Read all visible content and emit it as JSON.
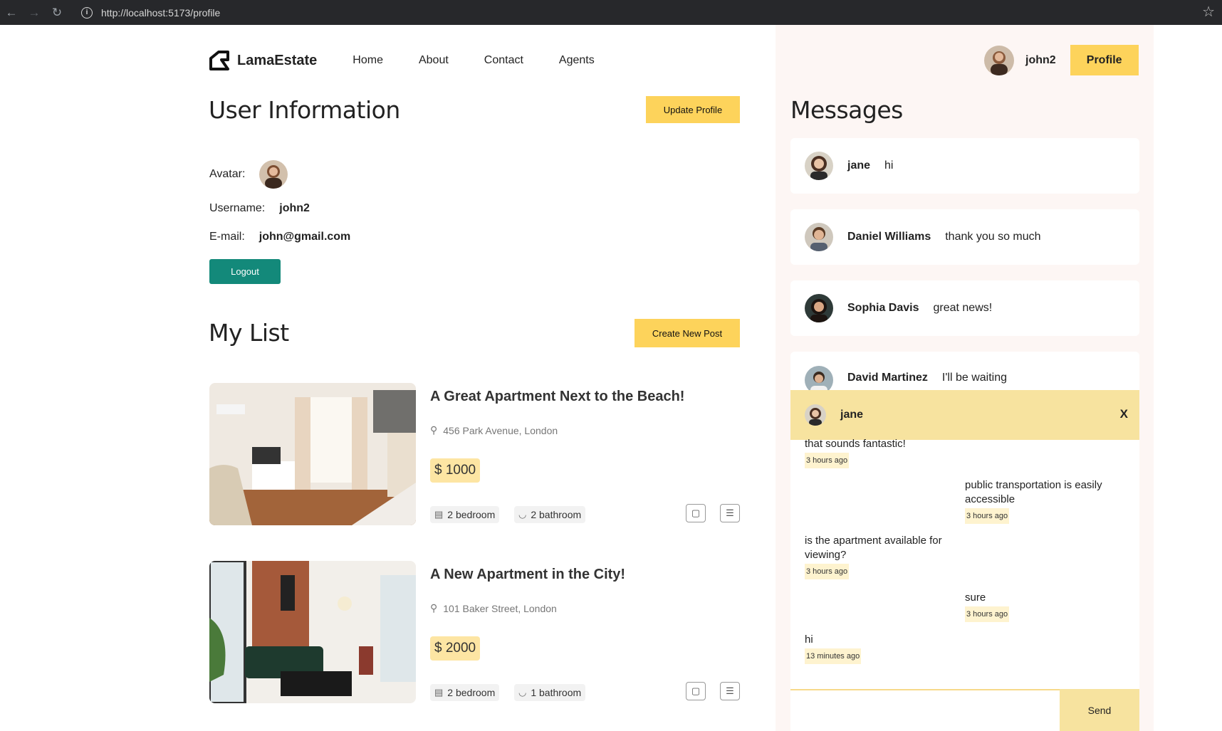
{
  "browser": {
    "url": "http://localhost:5173/profile"
  },
  "navbar": {
    "logo_text": "LamaEstate",
    "links": [
      "Home",
      "About",
      "Contact",
      "Agents"
    ],
    "username": "john2",
    "profile_label": "Profile"
  },
  "user_info": {
    "title": "User Information",
    "update_label": "Update Profile",
    "avatar_label": "Avatar:",
    "username_label": "Username:",
    "username_value": "john2",
    "email_label": "E-mail:",
    "email_value": "john@gmail.com",
    "logout_label": "Logout"
  },
  "my_list": {
    "title": "My List",
    "create_label": "Create New Post",
    "posts": [
      {
        "title": "A Great Apartment Next to the Beach!",
        "address": "456 Park Avenue, London",
        "price": "$ 1000",
        "bedroom": "2 bedroom",
        "bathroom": "2 bathroom"
      },
      {
        "title": "A New Apartment in the City!",
        "address": "101 Baker Street, London",
        "price": "$ 2000",
        "bedroom": "2 bedroom",
        "bathroom": "1 bathroom"
      }
    ]
  },
  "messages": {
    "title": "Messages",
    "items": [
      {
        "name": "jane",
        "text": "hi"
      },
      {
        "name": "Daniel Williams",
        "text": "thank you so much"
      },
      {
        "name": "Sophia Davis",
        "text": "great news!"
      },
      {
        "name": "David Martinez",
        "text": "I'll be waiting"
      }
    ]
  },
  "chat": {
    "name": "jane",
    "close_label": "X",
    "messages": [
      {
        "text": "that sounds fantastic!",
        "time": "3 hours ago"
      },
      {
        "text": "public transportation is easily accessible",
        "time": "3 hours ago"
      },
      {
        "text": "is the apartment available for viewing?",
        "time": "3 hours ago"
      },
      {
        "text": "sure",
        "time": "3 hours ago"
      },
      {
        "text": "hi",
        "time": "13 minutes ago"
      }
    ],
    "send_label": "Send"
  },
  "colors": {
    "accent": "#fdd35b",
    "logout": "#13897a",
    "chat_header": "#f7e39f"
  }
}
